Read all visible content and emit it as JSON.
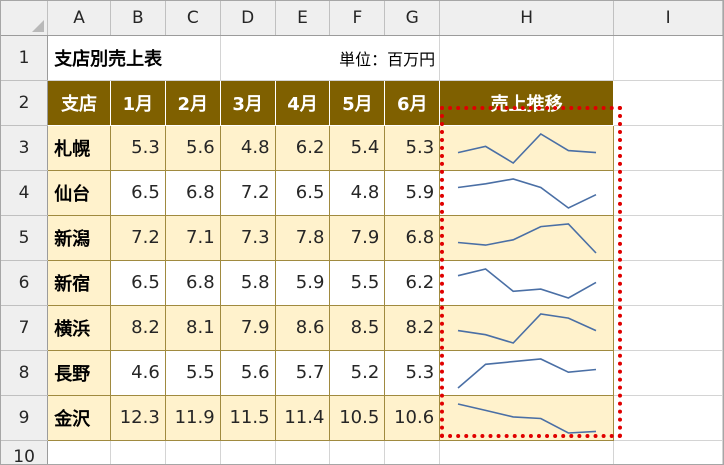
{
  "columns": [
    "A",
    "B",
    "C",
    "D",
    "E",
    "F",
    "G",
    "H",
    "I"
  ],
  "rows": [
    "1",
    "2",
    "3",
    "4",
    "5",
    "6",
    "7",
    "8",
    "9",
    "10"
  ],
  "title": "支店別売上表",
  "unit": "単位：百万円",
  "header": {
    "branch": "支店",
    "months": [
      "1月",
      "2月",
      "3月",
      "4月",
      "5月",
      "6月"
    ],
    "trend": "売上推移"
  },
  "data": [
    {
      "branch": "札幌",
      "values": [
        "5.3",
        "5.6",
        "4.8",
        "6.2",
        "5.4",
        "5.3"
      ]
    },
    {
      "branch": "仙台",
      "values": [
        "6.5",
        "6.8",
        "7.2",
        "6.5",
        "4.8",
        "5.9"
      ]
    },
    {
      "branch": "新潟",
      "values": [
        "7.2",
        "7.1",
        "7.3",
        "7.8",
        "7.9",
        "6.8"
      ]
    },
    {
      "branch": "新宿",
      "values": [
        "6.5",
        "6.8",
        "5.8",
        "5.9",
        "5.5",
        "6.2"
      ]
    },
    {
      "branch": "横浜",
      "values": [
        "8.2",
        "8.1",
        "7.9",
        "8.6",
        "8.5",
        "8.2"
      ]
    },
    {
      "branch": "長野",
      "values": [
        "4.6",
        "5.5",
        "5.6",
        "5.7",
        "5.2",
        "5.3"
      ]
    },
    {
      "branch": "金沢",
      "values": [
        "12.3",
        "11.9",
        "11.5",
        "11.4",
        "10.5",
        "10.6"
      ]
    }
  ],
  "colors": {
    "header_fill": "#7f6000",
    "header_text": "#ffffff",
    "band_fill": "#fff2cc",
    "sparkline": "#4a6fa5",
    "selection": "#e00000"
  }
}
